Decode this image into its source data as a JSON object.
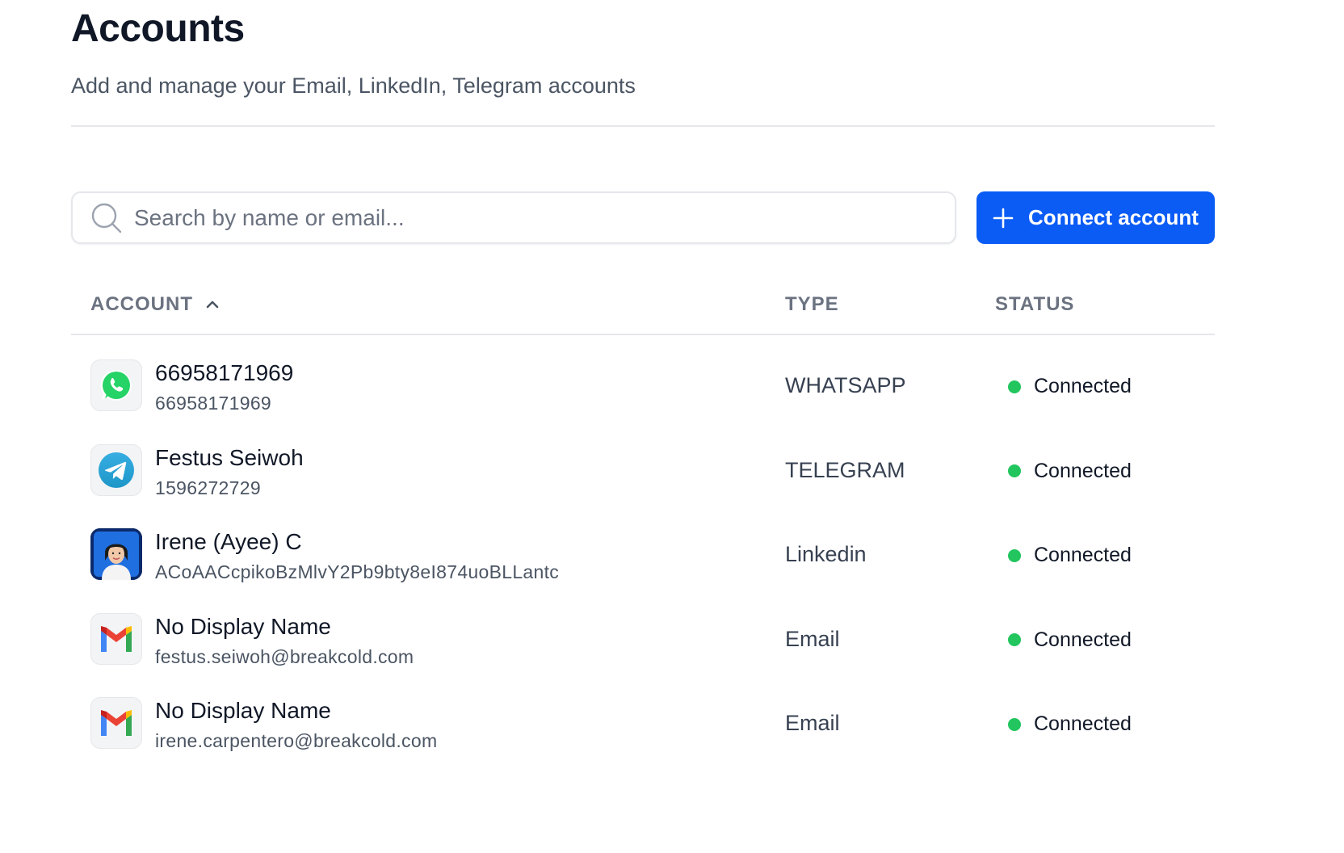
{
  "header": {
    "title": "Accounts",
    "subtitle": "Add and manage your Email, LinkedIn, Telegram accounts"
  },
  "search": {
    "placeholder": "Search by name or email...",
    "value": ""
  },
  "toolbar": {
    "connect_label": "Connect account"
  },
  "colors": {
    "primary": "#0a5cf5",
    "connected": "#22c55e"
  },
  "table": {
    "columns": {
      "account": "ACCOUNT",
      "type": "TYPE",
      "status": "STATUS"
    },
    "sort": {
      "column": "account",
      "direction": "ascending",
      "icon": "chevron-up-icon"
    },
    "rows": [
      {
        "icon": "whatsapp-icon",
        "name": "66958171969",
        "id": "66958171969",
        "type": "WHATSAPP",
        "status": "Connected"
      },
      {
        "icon": "telegram-icon",
        "name": "Festus Seiwoh",
        "id": "1596272729",
        "type": "TELEGRAM",
        "status": "Connected"
      },
      {
        "icon": "profile-photo",
        "name": "Irene (Ayee) C",
        "id": "ACoAACcpikoBzMlvY2Pb9bty8eI874uoBLLantc",
        "type": "Linkedin",
        "status": "Connected"
      },
      {
        "icon": "gmail-icon",
        "name": "No Display Name",
        "id": "festus.seiwoh@breakcold.com",
        "type": "Email",
        "status": "Connected"
      },
      {
        "icon": "gmail-icon",
        "name": "No Display Name",
        "id": "irene.carpentero@breakcold.com",
        "type": "Email",
        "status": "Connected"
      }
    ]
  }
}
